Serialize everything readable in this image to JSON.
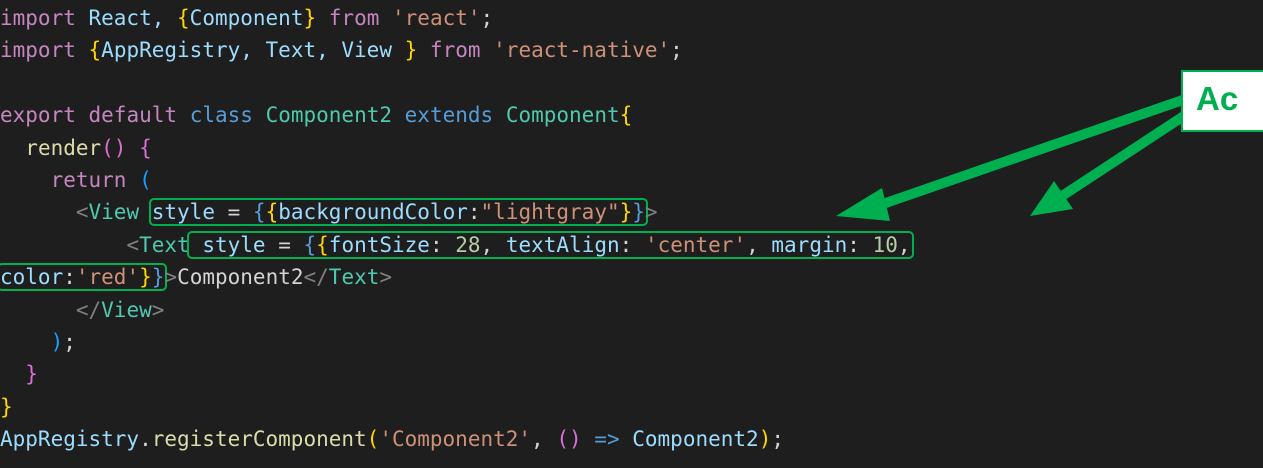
{
  "colors": {
    "keyword_purple": "#c586c0",
    "keyword_blue": "#569cd6",
    "identifier": "#9cdcfe",
    "type": "#4ec9b0",
    "string": "#ce9178",
    "number": "#b5cea8",
    "plain": "#d4d4d4",
    "function": "#dcdcaa",
    "brace_gold": "#ffd700",
    "brace_pink": "#da70d6",
    "brace_blue": "#179fff",
    "tag_punct": "#808080",
    "annotation_green": "#00b050",
    "background": "#1e1e1e"
  },
  "annotation": {
    "label": "Ac"
  },
  "code": {
    "lines": [
      [
        {
          "t": "import",
          "c": "keyword_purple"
        },
        {
          "t": " React, ",
          "c": "identifier"
        },
        {
          "t": "{",
          "c": "brace_gold"
        },
        {
          "t": "Component",
          "c": "identifier"
        },
        {
          "t": "}",
          "c": "brace_gold"
        },
        {
          "t": " ",
          "c": "plain"
        },
        {
          "t": "from",
          "c": "keyword_purple"
        },
        {
          "t": " ",
          "c": "plain"
        },
        {
          "t": "'react'",
          "c": "string"
        },
        {
          "t": ";",
          "c": "plain"
        }
      ],
      [
        {
          "t": "import",
          "c": "keyword_purple"
        },
        {
          "t": " ",
          "c": "plain"
        },
        {
          "t": "{",
          "c": "brace_gold"
        },
        {
          "t": "AppRegistry, Text, View ",
          "c": "identifier"
        },
        {
          "t": "}",
          "c": "brace_gold"
        },
        {
          "t": " ",
          "c": "plain"
        },
        {
          "t": "from",
          "c": "keyword_purple"
        },
        {
          "t": " ",
          "c": "plain"
        },
        {
          "t": "'react-native'",
          "c": "string"
        },
        {
          "t": ";",
          "c": "plain"
        }
      ],
      [],
      [
        {
          "t": "export",
          "c": "keyword_purple"
        },
        {
          "t": " ",
          "c": "plain"
        },
        {
          "t": "default",
          "c": "keyword_purple"
        },
        {
          "t": " ",
          "c": "plain"
        },
        {
          "t": "class",
          "c": "keyword_blue"
        },
        {
          "t": " ",
          "c": "plain"
        },
        {
          "t": "Component2",
          "c": "type"
        },
        {
          "t": " ",
          "c": "plain"
        },
        {
          "t": "extends",
          "c": "keyword_blue"
        },
        {
          "t": " ",
          "c": "plain"
        },
        {
          "t": "Component",
          "c": "type"
        },
        {
          "t": "{",
          "c": "brace_gold"
        }
      ],
      [
        {
          "t": "  ",
          "c": "plain"
        },
        {
          "t": "render",
          "c": "function"
        },
        {
          "t": "()",
          "c": "brace_pink"
        },
        {
          "t": " ",
          "c": "plain"
        },
        {
          "t": "{",
          "c": "brace_pink"
        }
      ],
      [
        {
          "t": "    ",
          "c": "plain"
        },
        {
          "t": "return",
          "c": "keyword_purple"
        },
        {
          "t": " ",
          "c": "plain"
        },
        {
          "t": "(",
          "c": "brace_blue"
        }
      ],
      [
        {
          "t": "      ",
          "c": "plain"
        },
        {
          "t": "<",
          "c": "tag_punct"
        },
        {
          "t": "View",
          "c": "type"
        },
        {
          "t": " ",
          "c": "plain"
        },
        {
          "t": "style",
          "c": "identifier",
          "box": "start"
        },
        {
          "t": " = ",
          "c": "plain"
        },
        {
          "t": "{",
          "c": "keyword_blue"
        },
        {
          "t": "{",
          "c": "brace_gold"
        },
        {
          "t": "backgroundColor",
          "c": "identifier"
        },
        {
          "t": ":",
          "c": "plain"
        },
        {
          "t": "\"lightgray\"",
          "c": "string"
        },
        {
          "t": "}",
          "c": "brace_gold"
        },
        {
          "t": "}",
          "c": "keyword_blue",
          "box": "end"
        },
        {
          "t": ">",
          "c": "tag_punct"
        }
      ],
      [
        {
          "t": "          ",
          "c": "plain"
        },
        {
          "t": "<",
          "c": "tag_punct"
        },
        {
          "t": "Text",
          "c": "type"
        },
        {
          "t": " ",
          "c": "plain",
          "box": "start"
        },
        {
          "t": "style",
          "c": "identifier"
        },
        {
          "t": " = ",
          "c": "plain"
        },
        {
          "t": "{",
          "c": "keyword_blue"
        },
        {
          "t": "{",
          "c": "brace_gold"
        },
        {
          "t": "fontSize",
          "c": "identifier"
        },
        {
          "t": ": ",
          "c": "plain"
        },
        {
          "t": "28",
          "c": "number"
        },
        {
          "t": ", ",
          "c": "plain"
        },
        {
          "t": "textAlign",
          "c": "identifier"
        },
        {
          "t": ": ",
          "c": "plain"
        },
        {
          "t": "'center'",
          "c": "string"
        },
        {
          "t": ", ",
          "c": "plain"
        },
        {
          "t": "margin",
          "c": "identifier"
        },
        {
          "t": ": ",
          "c": "plain"
        },
        {
          "t": "10",
          "c": "number"
        },
        {
          "t": ",",
          "c": "plain",
          "box": "end"
        }
      ],
      [
        {
          "t": "color",
          "c": "identifier",
          "box": "start"
        },
        {
          "t": ":",
          "c": "plain"
        },
        {
          "t": "'red'",
          "c": "string"
        },
        {
          "t": "}",
          "c": "brace_gold"
        },
        {
          "t": "}",
          "c": "keyword_blue",
          "box": "end"
        },
        {
          "t": ">",
          "c": "tag_punct"
        },
        {
          "t": "Component2",
          "c": "plain"
        },
        {
          "t": "</",
          "c": "tag_punct"
        },
        {
          "t": "Text",
          "c": "type"
        },
        {
          "t": ">",
          "c": "tag_punct"
        }
      ],
      [
        {
          "t": "      ",
          "c": "plain"
        },
        {
          "t": "</",
          "c": "tag_punct"
        },
        {
          "t": "View",
          "c": "type"
        },
        {
          "t": ">",
          "c": "tag_punct"
        }
      ],
      [
        {
          "t": "    ",
          "c": "plain"
        },
        {
          "t": ")",
          "c": "brace_blue"
        },
        {
          "t": ";",
          "c": "plain"
        }
      ],
      [
        {
          "t": "  ",
          "c": "plain"
        },
        {
          "t": "}",
          "c": "brace_pink"
        }
      ],
      [
        {
          "t": "}",
          "c": "brace_gold"
        }
      ],
      [
        {
          "t": "AppRegistry",
          "c": "identifier"
        },
        {
          "t": ".",
          "c": "plain"
        },
        {
          "t": "registerComponent",
          "c": "function"
        },
        {
          "t": "(",
          "c": "brace_gold"
        },
        {
          "t": "'Component2'",
          "c": "string"
        },
        {
          "t": ", ",
          "c": "plain"
        },
        {
          "t": "()",
          "c": "brace_pink"
        },
        {
          "t": " ",
          "c": "plain"
        },
        {
          "t": "=>",
          "c": "keyword_blue"
        },
        {
          "t": " ",
          "c": "plain"
        },
        {
          "t": "Component2",
          "c": "identifier"
        },
        {
          "t": ")",
          "c": "brace_gold"
        },
        {
          "t": ";",
          "c": "plain"
        }
      ]
    ]
  }
}
